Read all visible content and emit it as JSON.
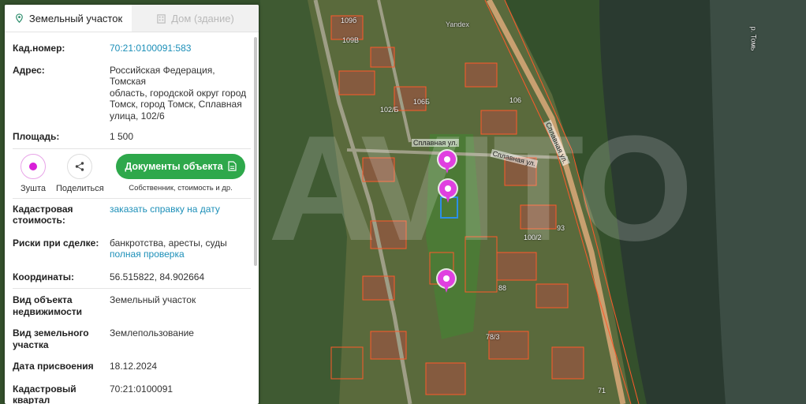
{
  "tabs": {
    "land": "Земельный участок",
    "house": "Дом (здание)"
  },
  "fields": {
    "cadastral_number": {
      "label": "Кад.номер:",
      "value": "70:21:0100091:583"
    },
    "address": {
      "label": "Адрес:",
      "lines": [
        "Российская Федерация, Томская",
        "область, городской округ город",
        "Томск, город Томск, Сплавная",
        "улица, 102/6"
      ]
    },
    "area": {
      "label": "Площадь:",
      "value": "1 500"
    },
    "cadastral_value": {
      "label_lines": [
        "Кадастровая",
        "стоимость:"
      ],
      "link": "заказать справку на дату"
    },
    "risks": {
      "label": "Риски при сделке:",
      "value": "банкротства, аресты, суды",
      "link": "полная проверка"
    },
    "coordinates": {
      "label": "Координаты:",
      "value": "56.515822, 84.902664"
    },
    "object_type": {
      "label_lines": [
        "Вид объекта",
        "недвижимости"
      ],
      "value": "Земельный участок"
    },
    "land_use": {
      "label_lines": [
        "Вид земельного",
        "участка"
      ],
      "value": "Землепользование"
    },
    "assign_date": {
      "label": "Дата присвоения",
      "value": "18.12.2024"
    },
    "cadastral_block": {
      "label_lines": [
        "Кадастровый",
        "квартал"
      ],
      "value": "70:21:0100091"
    }
  },
  "actions": {
    "zushta": "Зушта",
    "share": "Поделиться",
    "documents": "Документы объекта",
    "documents_sub": "Собственник, стоимость и др."
  },
  "map": {
    "street_top": "Сплавная ул.",
    "street_right": "Сплавная ул.",
    "street_diag": "Сплавная ул.",
    "river": "р. Томь",
    "yandex": "Yandex",
    "watermark": "AVITO",
    "house_numbers": [
      "109б",
      "109В",
      "106Б",
      "102/Б",
      "106",
      "100/2",
      "93",
      "88",
      "78/3",
      "71"
    ]
  },
  "colors": {
    "accent_green": "#2ea84b",
    "link_blue": "#1c8fb8",
    "pin_magenta": "#e040e0",
    "parcel_outline": "#ff5a2a"
  }
}
